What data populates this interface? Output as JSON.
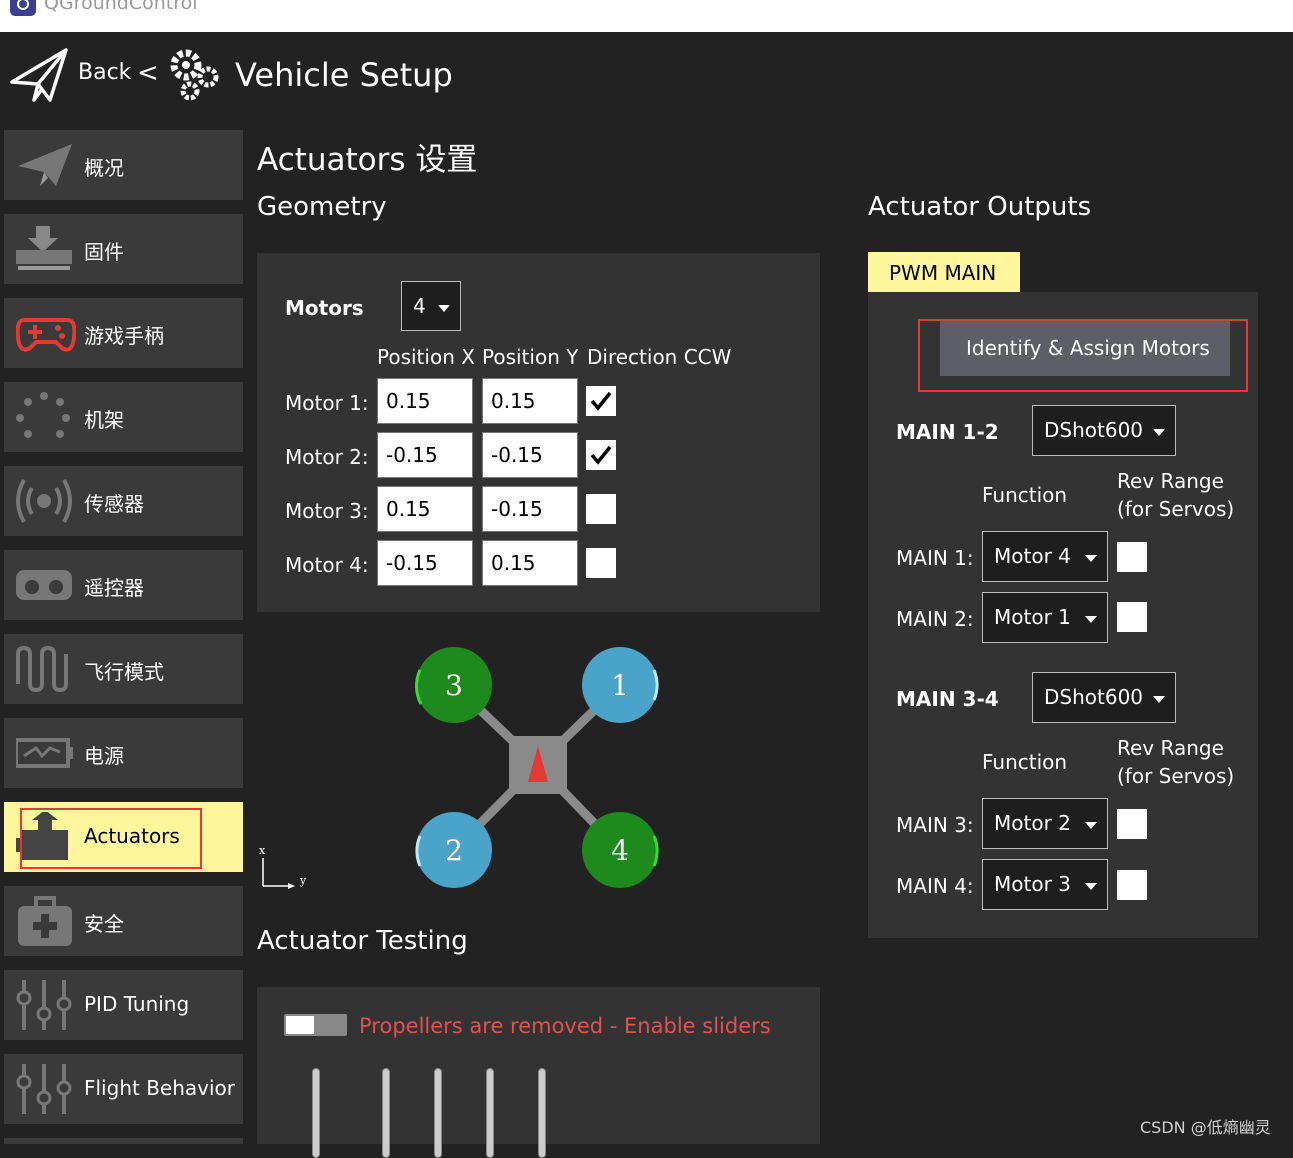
{
  "window": {
    "title": "QGroundControl"
  },
  "header": {
    "back_label": "Back",
    "separator": "<",
    "title": "Vehicle Setup"
  },
  "sidebar": {
    "items": [
      {
        "label": "概况",
        "icon": "paper-plane-icon"
      },
      {
        "label": "固件",
        "icon": "download-icon"
      },
      {
        "label": "游戏手柄",
        "icon": "gamepad-icon"
      },
      {
        "label": "机架",
        "icon": "frame-icon"
      },
      {
        "label": "传感器",
        "icon": "sensor-icon"
      },
      {
        "label": "遥控器",
        "icon": "radio-icon"
      },
      {
        "label": "飞行模式",
        "icon": "flight-modes-icon"
      },
      {
        "label": "电源",
        "icon": "battery-icon"
      },
      {
        "label": "Actuators",
        "icon": "actuator-icon",
        "active": true
      },
      {
        "label": "安全",
        "icon": "safety-icon"
      },
      {
        "label": "PID Tuning",
        "icon": "sliders-icon"
      },
      {
        "label": "Flight Behavior",
        "icon": "sliders-icon"
      }
    ]
  },
  "page": {
    "title": "Actuators 设置"
  },
  "geometry": {
    "title": "Geometry",
    "motors_label": "Motors",
    "motors_value": "4",
    "columns": [
      "Position X",
      "Position Y",
      "Direction CCW"
    ],
    "rows": [
      {
        "label": "Motor 1:",
        "x": "0.15",
        "y": "0.15",
        "ccw": true
      },
      {
        "label": "Motor 2:",
        "x": "-0.15",
        "y": "-0.15",
        "ccw": true
      },
      {
        "label": "Motor 3:",
        "x": "0.15",
        "y": "-0.15",
        "ccw": false
      },
      {
        "label": "Motor 4:",
        "x": "-0.15",
        "y": "0.15",
        "ccw": false
      }
    ]
  },
  "diagram": {
    "motors": [
      {
        "number": "3",
        "color": "#1e8a1e"
      },
      {
        "number": "1",
        "color": "#4aa3c9"
      },
      {
        "number": "2",
        "color": "#4aa3c9"
      },
      {
        "number": "4",
        "color": "#1e8a1e"
      }
    ],
    "axis_x": "x",
    "axis_y": "y"
  },
  "outputs": {
    "title": "Actuator Outputs",
    "tab": "PWM MAIN",
    "identify_button": "Identify & Assign Motors",
    "groups": [
      {
        "label": "MAIN 1-2",
        "protocol": "DShot600",
        "function_header": "Function",
        "rev_header_1": "Rev Range",
        "rev_header_2": "(for Servos)",
        "rows": [
          {
            "label": "MAIN 1:",
            "function": "Motor 4",
            "rev": false
          },
          {
            "label": "MAIN 2:",
            "function": "Motor 1",
            "rev": false
          }
        ]
      },
      {
        "label": "MAIN 3-4",
        "protocol": "DShot600",
        "function_header": "Function",
        "rev_header_1": "Rev Range",
        "rev_header_2": "(for Servos)",
        "rows": [
          {
            "label": "MAIN 3:",
            "function": "Motor 2",
            "rev": false
          },
          {
            "label": "MAIN 4:",
            "function": "Motor 3",
            "rev": false
          }
        ]
      }
    ]
  },
  "testing": {
    "title": "Actuator Testing",
    "enable_toggle": false,
    "warning": "Propellers are removed - Enable sliders"
  },
  "watermark": "CSDN @低熵幽灵",
  "colors": {
    "active": "#fff59d",
    "highlight_box": "#e53935",
    "warning": "#e05252"
  }
}
